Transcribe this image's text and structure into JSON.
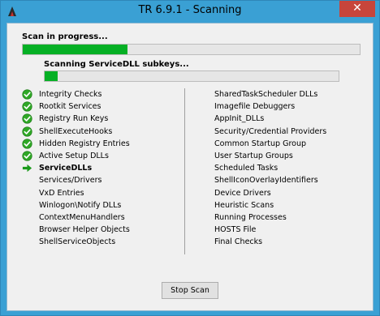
{
  "window": {
    "title": "TR 6.9.1 - Scanning",
    "close_glyph": "✕"
  },
  "main_progress": {
    "label": "Scan in progress...",
    "value_fraction": 0.31
  },
  "sub_progress": {
    "label": "Scanning ServiceDLL subkeys...",
    "value_fraction": 0.045
  },
  "checks_left": [
    {
      "label": "Integrity Checks",
      "status": "done"
    },
    {
      "label": "Rootkit Services",
      "status": "done"
    },
    {
      "label": "Registry Run Keys",
      "status": "done"
    },
    {
      "label": "ShellExecuteHooks",
      "status": "done"
    },
    {
      "label": "Hidden Registry Entries",
      "status": "done"
    },
    {
      "label": "Active Setup DLLs",
      "status": "done"
    },
    {
      "label": "ServiceDLLs",
      "status": "current"
    },
    {
      "label": "Services/Drivers",
      "status": "pending"
    },
    {
      "label": "VxD Entries",
      "status": "pending"
    },
    {
      "label": "Winlogon\\Notify DLLs",
      "status": "pending"
    },
    {
      "label": "ContextMenuHandlers",
      "status": "pending"
    },
    {
      "label": "Browser Helper Objects",
      "status": "pending"
    },
    {
      "label": "ShellServiceObjects",
      "status": "pending"
    }
  ],
  "checks_right": [
    {
      "label": "SharedTaskScheduler DLLs",
      "status": "pending"
    },
    {
      "label": "Imagefile Debuggers",
      "status": "pending"
    },
    {
      "label": "AppInit_DLLs",
      "status": "pending"
    },
    {
      "label": "Security/Credential Providers",
      "status": "pending"
    },
    {
      "label": "Common Startup Group",
      "status": "pending"
    },
    {
      "label": "User Startup Groups",
      "status": "pending"
    },
    {
      "label": "Scheduled Tasks",
      "status": "pending"
    },
    {
      "label": "ShellIconOverlayIdentifiers",
      "status": "pending"
    },
    {
      "label": "Device Drivers",
      "status": "pending"
    },
    {
      "label": "Heuristic Scans",
      "status": "pending"
    },
    {
      "label": "Running Processes",
      "status": "pending"
    },
    {
      "label": "HOSTS File",
      "status": "pending"
    },
    {
      "label": "Final Checks",
      "status": "pending"
    }
  ],
  "buttons": {
    "stop_label": "Stop Scan"
  },
  "colors": {
    "progress_fill": "#06b025",
    "check_green": "#2fa826",
    "arrow_green": "#1a9a1a",
    "titlebar": "#3aa0d4",
    "close": "#c7453b"
  },
  "icons": {
    "done": "checkmark-icon",
    "current": "arrow-right-icon",
    "app": "app-icon"
  }
}
